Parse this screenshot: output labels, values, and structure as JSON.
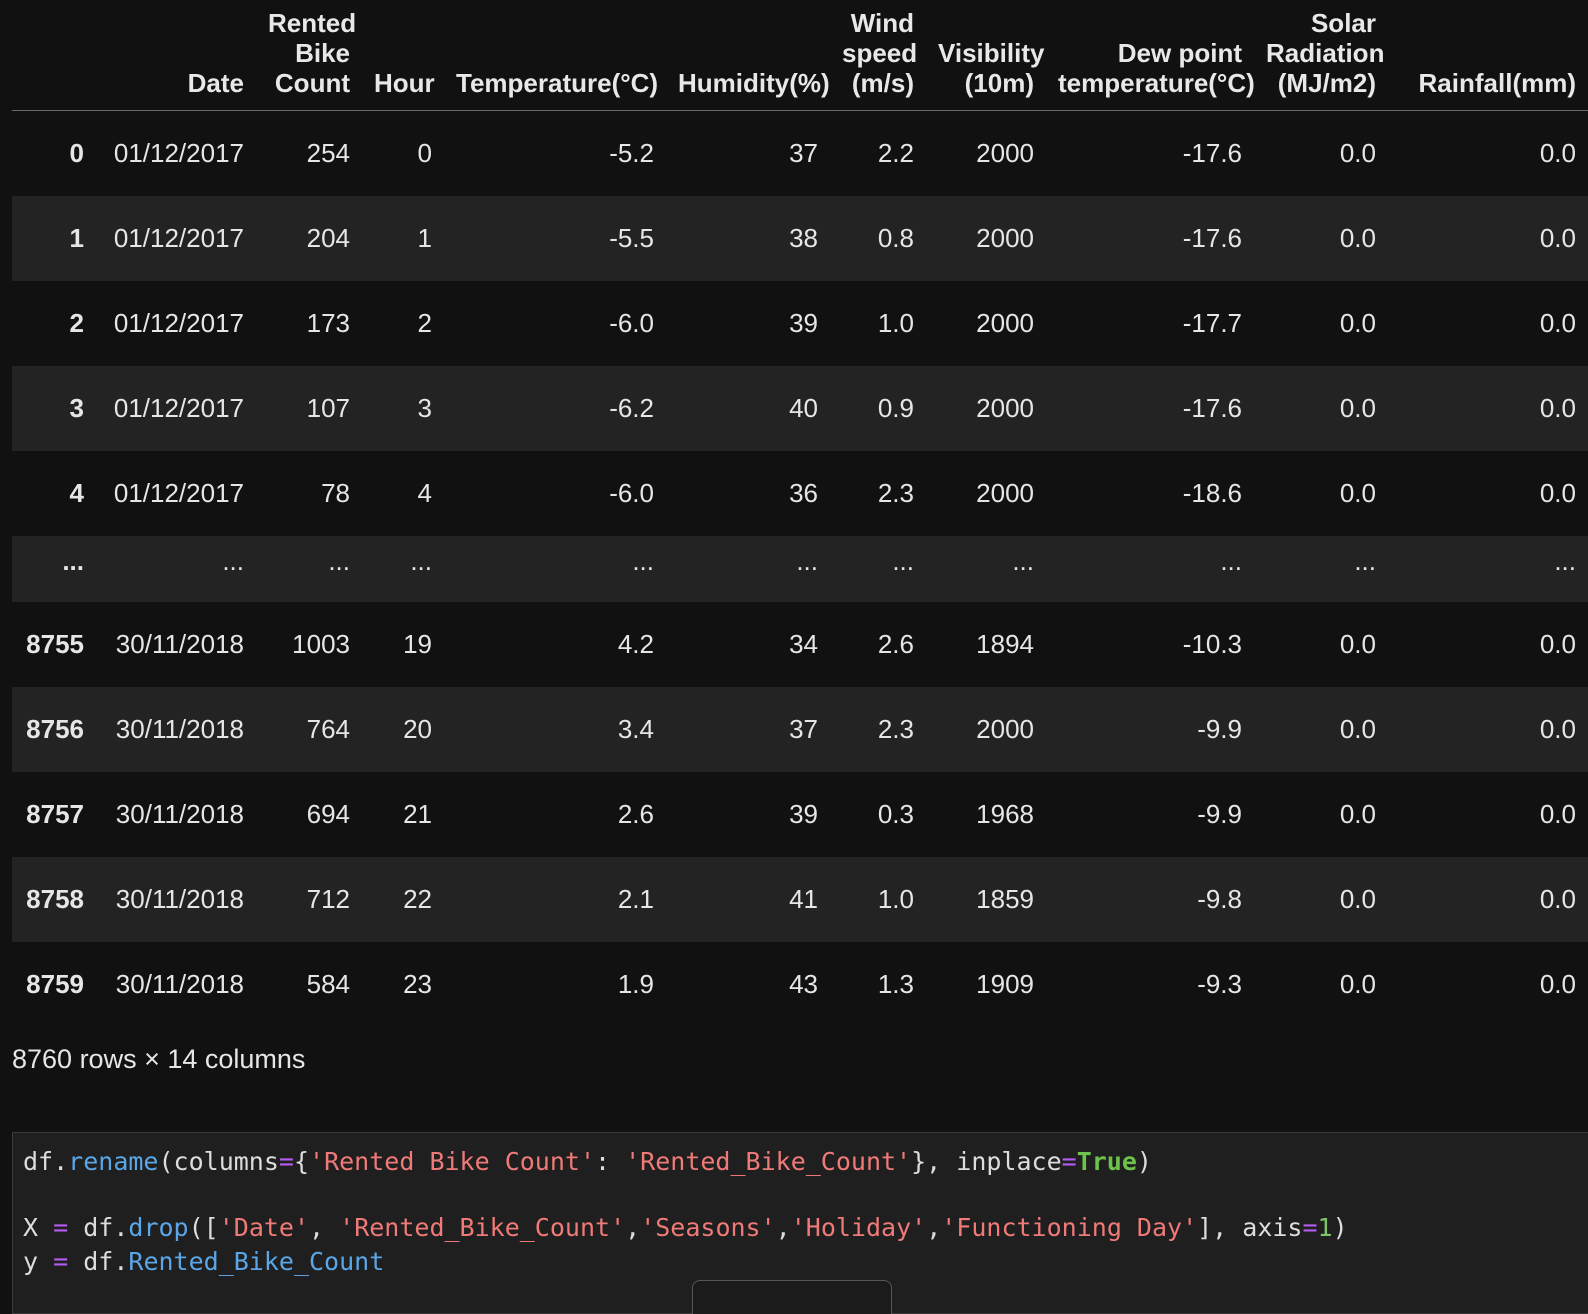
{
  "dataframe": {
    "columns": [
      "",
      "Date",
      "Rented\nBike\nCount",
      "Hour",
      "Temperature(°C)",
      "Humidity(%)",
      "Wind\nspeed\n(m/s)",
      "Visibility\n(10m)",
      "Dew point\ntemperature(°C)",
      "Solar\nRadiation\n(MJ/m2)",
      "Rainfall(mm)"
    ],
    "rows": [
      {
        "index": "0",
        "cells": [
          "01/12/2017",
          "254",
          "0",
          "-5.2",
          "37",
          "2.2",
          "2000",
          "-17.6",
          "0.0",
          "0.0"
        ]
      },
      {
        "index": "1",
        "cells": [
          "01/12/2017",
          "204",
          "1",
          "-5.5",
          "38",
          "0.8",
          "2000",
          "-17.6",
          "0.0",
          "0.0"
        ]
      },
      {
        "index": "2",
        "cells": [
          "01/12/2017",
          "173",
          "2",
          "-6.0",
          "39",
          "1.0",
          "2000",
          "-17.7",
          "0.0",
          "0.0"
        ]
      },
      {
        "index": "3",
        "cells": [
          "01/12/2017",
          "107",
          "3",
          "-6.2",
          "40",
          "0.9",
          "2000",
          "-17.6",
          "0.0",
          "0.0"
        ]
      },
      {
        "index": "4",
        "cells": [
          "01/12/2017",
          "78",
          "4",
          "-6.0",
          "36",
          "2.3",
          "2000",
          "-18.6",
          "0.0",
          "0.0"
        ]
      },
      {
        "index": "...",
        "cells": [
          "...",
          "...",
          "...",
          "...",
          "...",
          "...",
          "...",
          "...",
          "...",
          "..."
        ],
        "ellipsis": true
      },
      {
        "index": "8755",
        "cells": [
          "30/11/2018",
          "1003",
          "19",
          "4.2",
          "34",
          "2.6",
          "1894",
          "-10.3",
          "0.0",
          "0.0"
        ]
      },
      {
        "index": "8756",
        "cells": [
          "30/11/2018",
          "764",
          "20",
          "3.4",
          "37",
          "2.3",
          "2000",
          "-9.9",
          "0.0",
          "0.0"
        ]
      },
      {
        "index": "8757",
        "cells": [
          "30/11/2018",
          "694",
          "21",
          "2.6",
          "39",
          "0.3",
          "1968",
          "-9.9",
          "0.0",
          "0.0"
        ]
      },
      {
        "index": "8758",
        "cells": [
          "30/11/2018",
          "712",
          "22",
          "2.1",
          "41",
          "1.0",
          "1859",
          "-9.8",
          "0.0",
          "0.0"
        ]
      },
      {
        "index": "8759",
        "cells": [
          "30/11/2018",
          "584",
          "23",
          "1.9",
          "43",
          "1.3",
          "1909",
          "-9.3",
          "0.0",
          "0.0"
        ]
      }
    ],
    "shape_text": "8760 rows × 14 columns"
  },
  "code_cell": {
    "lines": [
      [
        {
          "t": "df",
          "c": "var"
        },
        {
          "t": ".",
          "c": "punc"
        },
        {
          "t": "rename",
          "c": "attr"
        },
        {
          "t": "(columns",
          "c": "punc"
        },
        {
          "t": "=",
          "c": "op"
        },
        {
          "t": "{",
          "c": "punc"
        },
        {
          "t": "'Rented Bike Count'",
          "c": "str"
        },
        {
          "t": ": ",
          "c": "punc"
        },
        {
          "t": "'Rented_Bike_Count'",
          "c": "str"
        },
        {
          "t": "}, inplace",
          "c": "punc"
        },
        {
          "t": "=",
          "c": "op"
        },
        {
          "t": "True",
          "c": "kw"
        },
        {
          "t": ")",
          "c": "punc"
        }
      ],
      [],
      [
        {
          "t": "X ",
          "c": "var"
        },
        {
          "t": "=",
          "c": "op"
        },
        {
          "t": " df",
          "c": "var"
        },
        {
          "t": ".",
          "c": "punc"
        },
        {
          "t": "drop",
          "c": "attr"
        },
        {
          "t": "([",
          "c": "punc"
        },
        {
          "t": "'Date'",
          "c": "str"
        },
        {
          "t": ", ",
          "c": "punc"
        },
        {
          "t": "'Rented_Bike_Count'",
          "c": "str"
        },
        {
          "t": ",",
          "c": "punc"
        },
        {
          "t": "'Seasons'",
          "c": "str"
        },
        {
          "t": ",",
          "c": "punc"
        },
        {
          "t": "'Holiday'",
          "c": "str"
        },
        {
          "t": ",",
          "c": "punc"
        },
        {
          "t": "'Functioning Day'",
          "c": "str"
        },
        {
          "t": "], axis",
          "c": "punc"
        },
        {
          "t": "=",
          "c": "op"
        },
        {
          "t": "1",
          "c": "num"
        },
        {
          "t": ")",
          "c": "punc"
        }
      ],
      [
        {
          "t": "y ",
          "c": "var"
        },
        {
          "t": "=",
          "c": "op"
        },
        {
          "t": " df",
          "c": "var"
        },
        {
          "t": ".",
          "c": "punc"
        },
        {
          "t": "Rented_Bike_Count",
          "c": "attr"
        }
      ]
    ]
  },
  "colors": {
    "background": "#111111",
    "row_alt": "#232323",
    "code_bg": "#1f1f1f",
    "string": "#ef7a78",
    "attribute": "#5aa6e6",
    "operator": "#b65cf0",
    "keyword": "#6cc24a"
  }
}
